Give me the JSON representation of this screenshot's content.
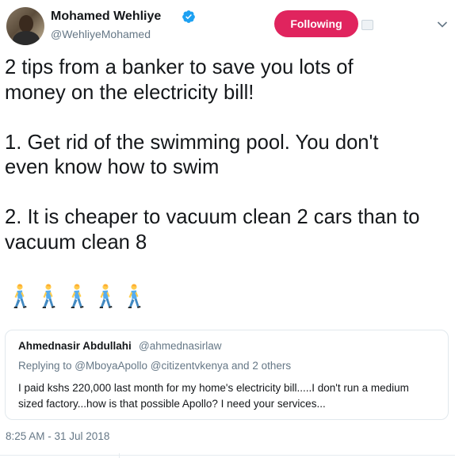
{
  "author": {
    "display_name": "Mohamed Wehliye",
    "handle": "@WehliyeMohamed",
    "verified": true,
    "verified_color": "#1da1f2"
  },
  "follow_button": {
    "label": "Following",
    "color": "#e0245e"
  },
  "icons": {
    "verified": "verified-badge-icon",
    "notifications": "notifications-icon",
    "more": "chevron-down-icon",
    "emoji": "person-walking-emoji"
  },
  "tweet": {
    "lines": [
      "2 tips from a banker to save you lots of",
      "money on the electricity bill!",
      "",
      "1. Get rid of the swimming pool. You don't",
      "even know how to swim",
      "",
      "2. It is cheaper to vacuum clean 2 cars than to",
      "vacuum clean 8"
    ],
    "emoji": [
      "🚶",
      "🚶",
      "🚶",
      "🚶",
      "🚶"
    ],
    "timestamp": "8:25 AM - 31 Jul 2018"
  },
  "quoted_tweet": {
    "display_name": "Ahmednasir Abdullahi",
    "handle": "@ahmednasirlaw",
    "replying_to": "Replying to @MboyaApollo @citizentvkenya and 2 others",
    "body_lines": [
      "I paid kshs 220,000 last month for my home's electricity bill.....I don't run a medium",
      "sized factory...how is that possible Apollo? I need your services..."
    ]
  }
}
